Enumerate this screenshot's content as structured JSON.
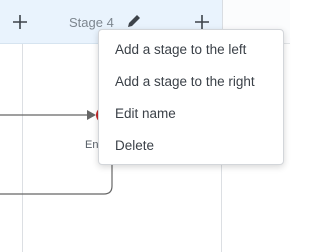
{
  "stage_header": {
    "title": "Stage 4"
  },
  "canvas": {
    "node_label": "End"
  },
  "context_menu": {
    "items": [
      {
        "label": "Add a stage to the left"
      },
      {
        "label": "Add a stage to the right"
      },
      {
        "label": "Edit name"
      },
      {
        "label": "Delete"
      }
    ]
  },
  "icons": {
    "add_left": "plus-icon",
    "add_right": "plus-icon",
    "edit": "pencil-icon"
  },
  "colors": {
    "header_background": "#e9f3fd",
    "end_node": "#c62828",
    "connector": "#666666"
  }
}
